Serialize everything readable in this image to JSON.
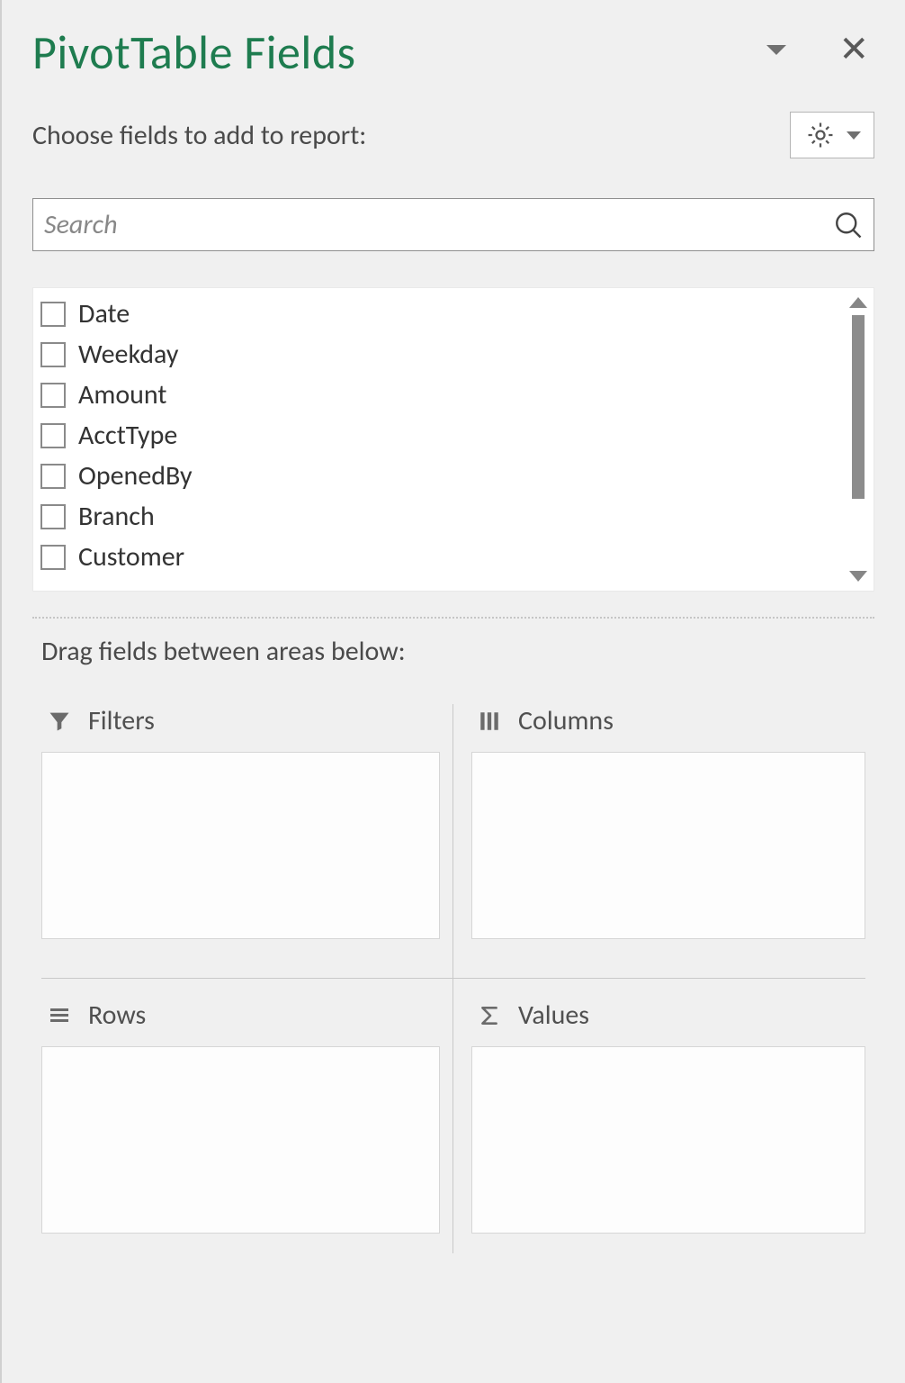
{
  "title": "PivotTable Fields",
  "subhead": "Choose fields to add to report:",
  "search": {
    "placeholder": "Search"
  },
  "fields": [
    {
      "label": "Date"
    },
    {
      "label": "Weekday"
    },
    {
      "label": "Amount"
    },
    {
      "label": "AcctType"
    },
    {
      "label": "OpenedBy"
    },
    {
      "label": "Branch"
    },
    {
      "label": "Customer"
    }
  ],
  "drag_label": "Drag fields between areas below:",
  "areas": {
    "filters": "Filters",
    "columns": "Columns",
    "rows": "Rows",
    "values": "Values"
  }
}
